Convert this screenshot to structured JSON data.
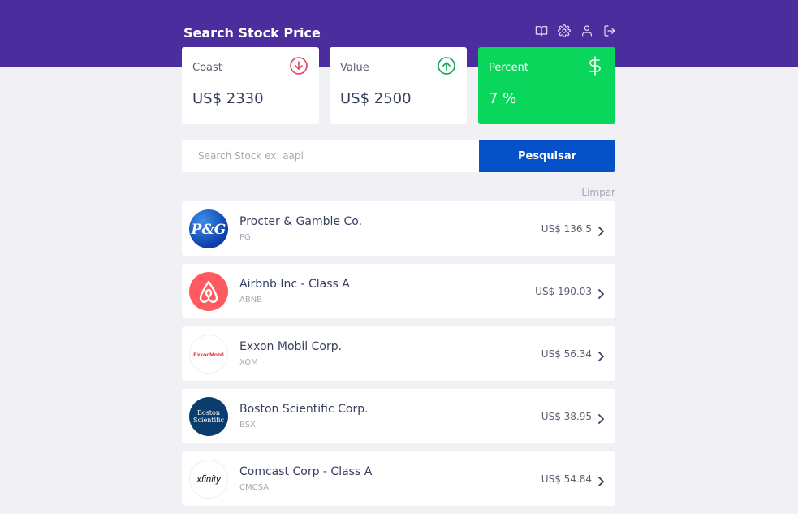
{
  "header": {
    "title": "Search Stock Price",
    "icons": [
      "book-icon",
      "gear-icon",
      "user-icon",
      "logout-icon"
    ]
  },
  "summary": {
    "cost": {
      "label": "Coast",
      "value": "US$ 2330",
      "icon": "arrow-down-circle-icon",
      "color": "#e83f5b"
    },
    "value": {
      "label": "Value",
      "value": "US$ 2500",
      "icon": "arrow-up-circle-icon",
      "color": "#12a454"
    },
    "percent": {
      "label": "Percent",
      "value": "7 %",
      "icon": "dollar-icon",
      "color": "#09d65a"
    }
  },
  "search": {
    "placeholder": "Search Stock ex: aapl",
    "value": "",
    "button_label": "Pesquisar"
  },
  "clear_label": "Limpar",
  "stocks": [
    {
      "name": "Procter & Gamble Co.",
      "ticker": "PG",
      "price": "US$ 136.5",
      "logo_text": "P&G"
    },
    {
      "name": "Airbnb Inc - Class A",
      "ticker": "ABNB",
      "price": "US$ 190.03",
      "logo_text": ""
    },
    {
      "name": "Exxon Mobil Corp.",
      "ticker": "XOM",
      "price": "US$ 56.34",
      "logo_text": "ExxonMobil"
    },
    {
      "name": "Boston Scientific Corp.",
      "ticker": "BSX",
      "price": "US$ 38.95",
      "logo_text": "Boston Scientific"
    },
    {
      "name": "Comcast Corp - Class A",
      "ticker": "CMCSA",
      "price": "US$ 54.84",
      "logo_text": "xfinity"
    }
  ],
  "colors": {
    "header": "#4c2d9e",
    "button": "#0650c8",
    "percent_card": "#09d65a",
    "down": "#e83f5b",
    "up": "#12a454"
  }
}
